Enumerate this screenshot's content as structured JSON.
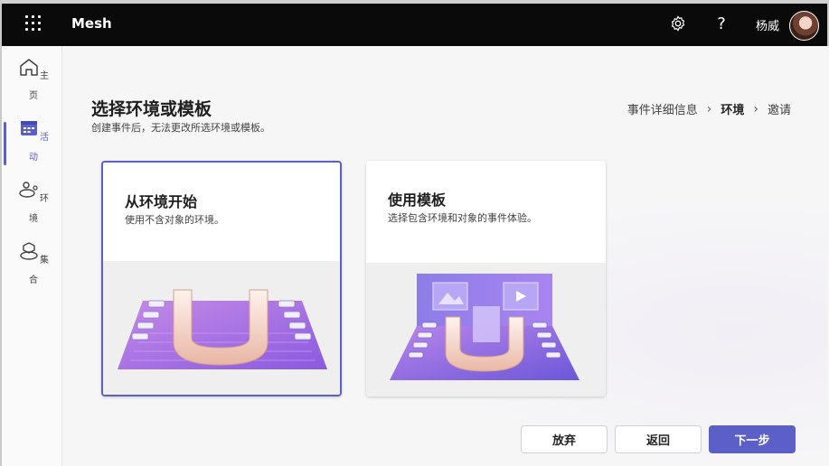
{
  "topbar": {
    "app_name": "Mesh",
    "help_label": "?",
    "user_name": "杨威"
  },
  "rail": {
    "items": [
      {
        "label_a": "主",
        "label_b": "页",
        "icon": "home-icon"
      },
      {
        "label_a": "活",
        "label_b": "动",
        "icon": "calendar-icon",
        "active": true
      },
      {
        "label_a": "环",
        "label_b": "境",
        "icon": "environments-icon"
      },
      {
        "label_a": "集",
        "label_b": "合",
        "icon": "collections-icon"
      }
    ]
  },
  "page": {
    "title": "选择环境或模板",
    "subtitle": "创建事件后，无法更改所选环境或模板。"
  },
  "breadcrumb": {
    "step1": "事件详细信息",
    "step2": "环境",
    "step3": "邀请"
  },
  "cards": [
    {
      "title": "从环境开始",
      "desc": "使用不含对象的环境。",
      "selected": true
    },
    {
      "title": "使用模板",
      "desc": "选择包含环境和对象的事件体验。",
      "selected": false
    }
  ],
  "buttons": {
    "discard": "放弃",
    "back": "返回",
    "next": "下一步"
  },
  "colors": {
    "accent": "#5b5fc7",
    "topbar": "#0a0a0a"
  }
}
